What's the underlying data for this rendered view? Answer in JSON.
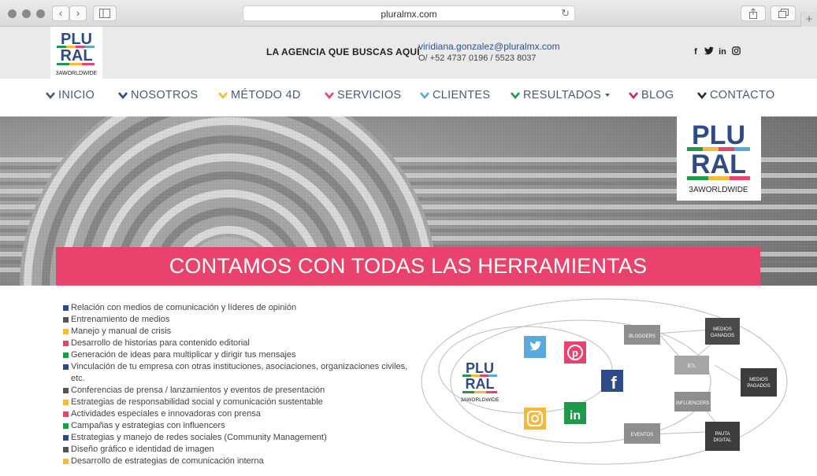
{
  "browser": {
    "url": "pluralmx.com",
    "back_icon": "‹",
    "forward_icon": "›",
    "reload_icon": "↻",
    "new_tab_icon": "+"
  },
  "header": {
    "logo_text_top": "PLU",
    "logo_text_bottom": "RAL",
    "logo_caption": "3AWORLDWIDE",
    "tagline": "LA AGENCIA QUE BUSCAS AQUÍ",
    "email": "viridiana.gonzalez@pluralmx.com",
    "phone": "O/ +52 4737 0196 / 5523 8037",
    "social": [
      {
        "name": "facebook-icon",
        "glyph": "f"
      },
      {
        "name": "twitter-icon",
        "glyph": "t"
      },
      {
        "name": "linkedin-icon",
        "glyph": "in"
      },
      {
        "name": "instagram-icon",
        "glyph": "◎"
      }
    ]
  },
  "nav": {
    "items": [
      {
        "label": "INICIO",
        "color": "#4a5a73"
      },
      {
        "label": "NOSOTROS",
        "color": "#2e4a88"
      },
      {
        "label": "MÉTODO 4D",
        "color": "#f4b93d"
      },
      {
        "label": "SERVICIOS",
        "color": "#e9436d"
      },
      {
        "label": "CLIENTES",
        "color": "#59a9dc"
      },
      {
        "label": "RESULTADOS",
        "color": "#1f9a4b"
      },
      {
        "label": "BLOG",
        "color": "#c4267c"
      },
      {
        "label": "CONTACTO",
        "color": "#2b2b2b"
      }
    ]
  },
  "hero": {
    "banner": "CONTAMOS CON TODAS LAS HERRAMIENTAS",
    "banner_color": "#e9436d"
  },
  "services": [
    {
      "text": "Relación con medios de comunicación y líderes de opinión",
      "color": "#2e4a88"
    },
    {
      "text": "Entrenamiento de medios",
      "color": "#555555"
    },
    {
      "text": "Manejo y manual de crisis",
      "color": "#f4b93d"
    },
    {
      "text": "Desarrollo de historias para contenido editorial",
      "color": "#e9436d"
    },
    {
      "text": "Generación de ideas para multiplicar y dirigir tus mensajes",
      "color": "#1f9a4b"
    },
    {
      "text": "Vinculación de tu empresa con otras instituciones, asociaciones, organizaciones civiles, etc.",
      "color": "#2e4a88"
    },
    {
      "text": "Conferencias de prensa / lanzamientos y eventos de presentación",
      "color": "#555555"
    },
    {
      "text": "Estrategias de responsabilidad social y comunicación sustentable",
      "color": "#f4b93d"
    },
    {
      "text": "Actividades especiales e innovadoras con prensa",
      "color": "#e9436d"
    },
    {
      "text": "Campañas y estrategias con influencers",
      "color": "#1f9a4b"
    },
    {
      "text": "Estrategias y manejo de redes sociales (Community Management)",
      "color": "#2e4a88"
    },
    {
      "text": "Diseño gráfico e identidad de imagen",
      "color": "#555555"
    },
    {
      "text": "Desarrollo de estrategias de comunicación interna",
      "color": "#f4b93d"
    }
  ],
  "diagram": {
    "logo_caption": "3AWORLDWIDE",
    "boxes": {
      "bloggers": "BLOGGERS",
      "medios_ganados": "MEDIOS GANADOS",
      "btl": "BTL",
      "medios_pagados": "MEDIOS PAGADOS",
      "influencers": "INFLUENCERS",
      "eventos": "EVENTOS",
      "pauta_digital": "PAUTA DIGITAL"
    },
    "social_icons": [
      "twitter-icon",
      "pinterest-icon",
      "facebook-icon",
      "instagram-icon",
      "linkedin-icon"
    ]
  }
}
